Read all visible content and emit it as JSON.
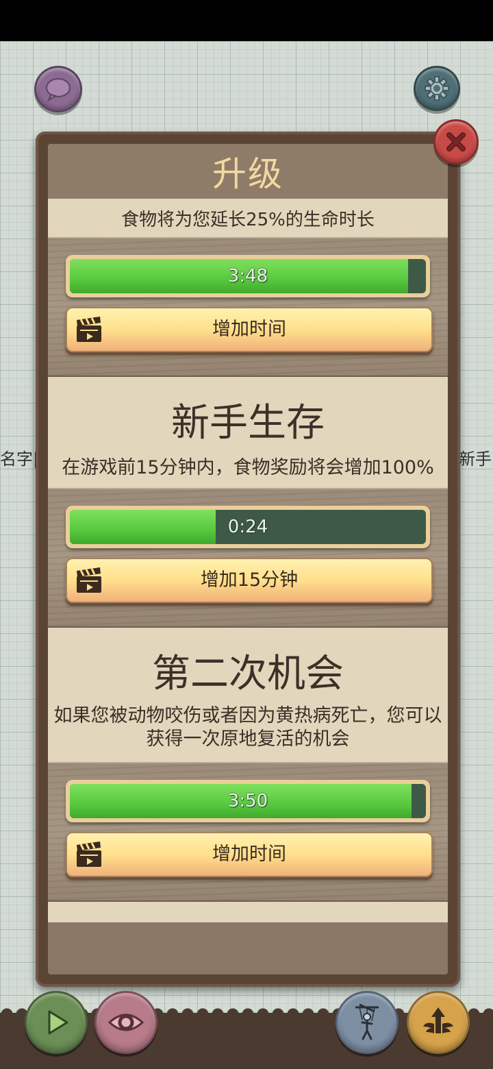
{
  "panel": {
    "title": "升级"
  },
  "sections": [
    {
      "description": "食物将为您延长25%的生命时长",
      "timer": "3:48",
      "progress": 0.95,
      "button_label": "增加时间"
    },
    {
      "title": "新手生存",
      "description": "在游戏前15分钟内，食物奖励将会增加100%",
      "timer": "0:24",
      "progress": 0.41,
      "button_label": "增加15分钟"
    },
    {
      "title": "第二次机会",
      "description": "如果您被动物咬伤或者因为黄热病死亡，您可以获得一次原地复活的机会",
      "timer": "3:50",
      "progress": 0.96,
      "button_label": "增加时间"
    }
  ],
  "background": {
    "left_text": "名字|",
    "right_text": "新手"
  },
  "icons": {
    "chat": "chat-bubble-icon",
    "settings": "gear-icon",
    "close": "close-x-icon",
    "ad": "clapperboard-icon",
    "play": "play-icon",
    "eye": "eye-icon",
    "puppet": "puppet-icon",
    "upgrade": "winged-arrow-icon"
  },
  "colors": {
    "progress_fill": "#57c93e",
    "progress_track": "#3e5a47",
    "panel_title": "#f2d9a4",
    "close_button": "#c94b48"
  }
}
